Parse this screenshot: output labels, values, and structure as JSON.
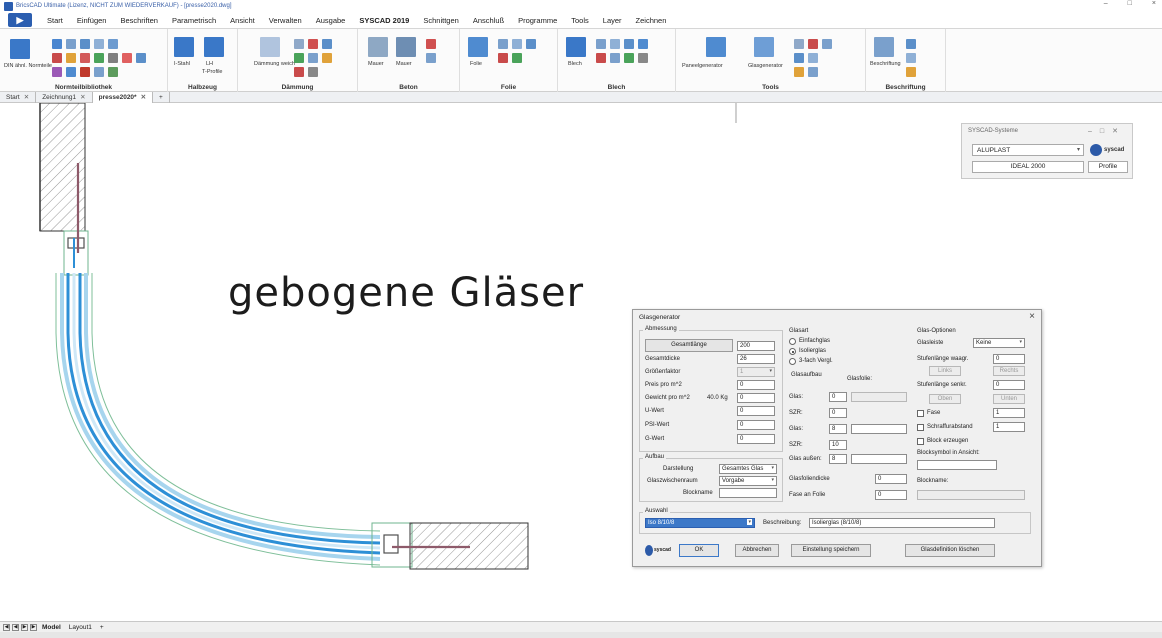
{
  "window": {
    "title": "BricsCAD Ultimate (Lizenz, NICHT ZUM WIEDERVERKAUF) - [presse2020.dwg]",
    "controls": [
      "–",
      "□",
      "×"
    ]
  },
  "ribbon_tabs": [
    "Start",
    "Einfügen",
    "Beschriften",
    "Parametrisch",
    "Ansicht",
    "Verwalten",
    "Ausgabe",
    "SYSCAD 2019",
    "Schnittgen",
    "Anschluß",
    "Programme",
    "Tools",
    "Layer",
    "Zeichnen"
  ],
  "active_tab_index": 7,
  "ribbon_groups": [
    {
      "label": "Normteilbibliothek",
      "items": [
        "DIN ähnl. Normteile"
      ]
    },
    {
      "label": "Halbzeug",
      "items": [
        "I-Stahl",
        "LH",
        "T-Profile"
      ]
    },
    {
      "label": "Dämmung",
      "items": [
        "Dämmung weich"
      ]
    },
    {
      "label": "Beton",
      "items": [
        "Mauer",
        "Mauer"
      ]
    },
    {
      "label": "Folie",
      "items": [
        "Folie"
      ]
    },
    {
      "label": "Blech",
      "items": [
        "Blech"
      ]
    },
    {
      "label": "Tools",
      "items": [
        "Paneelgenerator",
        "Glasgenerator"
      ]
    },
    {
      "label": "Beschriftung",
      "items": [
        "Beschriftung"
      ]
    }
  ],
  "document_tabs": [
    {
      "label": "Start",
      "active": false
    },
    {
      "label": "Zeichnung1",
      "active": false
    },
    {
      "label": "presse2020*",
      "active": true
    }
  ],
  "drawing": {
    "headline": "gebogene Gläser"
  },
  "syscad_palette": {
    "title": "SYSCAD-Systeme",
    "system": "ALUPLAST",
    "series": "IDEAL 2000",
    "profile_button": "Profile",
    "logo": "syscad"
  },
  "dialog": {
    "title": "Glasgenerator",
    "abmessung": {
      "section": "Abmessung",
      "gesamtlaenge_button": "Gesamtlänge",
      "gesamtlaenge": "200",
      "rows": [
        {
          "label": "Gesamtdicke",
          "value": "26"
        },
        {
          "label": "Größenfaktor",
          "value": "1"
        },
        {
          "label": "Preis pro m^2",
          "value": "0"
        },
        {
          "label": "Gewicht pro m^2",
          "extra": "40.0 Kg",
          "value": "0"
        },
        {
          "label": "U-Wert",
          "value": "0"
        },
        {
          "label": "PSI-Wert",
          "value": "0"
        },
        {
          "label": "G-Wert",
          "value": "0"
        }
      ]
    },
    "aufbau": {
      "section": "Aufbau",
      "darstellung_label": "Darstellung",
      "darstellung": "Gesamtes Glas",
      "glaszwischenraum_label": "Glaszwischenraum",
      "glaszwischenraum": "Vorgabe",
      "blockname_label": "Blockname",
      "blockname": ""
    },
    "glasart": {
      "section": "Glasart",
      "options": [
        "Einfachglas",
        "Isolierglas",
        "3-fach Vergl."
      ],
      "selected": 1,
      "glasaufbau_label": "Glasaufbau",
      "glasfolie_label": "Glasfolie:",
      "rows": [
        {
          "label": "Glas:",
          "value": "0"
        },
        {
          "label": "SZR:",
          "value": "0"
        },
        {
          "label": "Glas:",
          "value": "8"
        },
        {
          "label": "SZR:",
          "value": "10"
        },
        {
          "label": "Glas außen:",
          "value": "8"
        }
      ],
      "glasfoliendicke_label": "Glasfoliendicke",
      "glasfoliendicke": "0",
      "fase_an_folie_label": "Fase an Folie",
      "fase_an_folie": "0"
    },
    "glasoptionen": {
      "section": "Glas-Optionen",
      "glasleiste_label": "Glasleiste",
      "glasleiste": "Keine",
      "stufenlaenge_waag_label": "Stufenlänge waagr.",
      "stufenlaenge_waag": "0",
      "links": "Links",
      "rechts": "Rechts",
      "stufenlaenge_senk_label": "Stufenlänge senkr.",
      "stufenlaenge_senk": "0",
      "oben": "Oben",
      "unten": "Unten",
      "fase_label": "Fase",
      "fase": "1",
      "schraffur_label": "Schraffurabstand",
      "schraffur": "1",
      "block_label": "Block erzeugen",
      "blocksymbol_label": "Blocksymbol in Ansicht:",
      "blockname_label": "Blockname:"
    },
    "auswahl": {
      "section": "Auswahl",
      "selected": "Iso 8/10/8",
      "beschreibung_label": "Beschreibung:",
      "beschreibung": "Isolierglas (8/10/8)"
    },
    "buttons": {
      "ok": "OK",
      "abbrechen": "Abbrechen",
      "einstellung": "Einstellung speichern",
      "loeschen": "Glasdefinition löschen"
    }
  },
  "layout_tabs": [
    "Model",
    "Layout1",
    "+"
  ],
  "colors": {
    "ribbon_bg": "#fbfbfb",
    "accent": "#2b5eb0",
    "glass_blue": "#2d8fd6",
    "frame_green": "#6fb58f"
  }
}
